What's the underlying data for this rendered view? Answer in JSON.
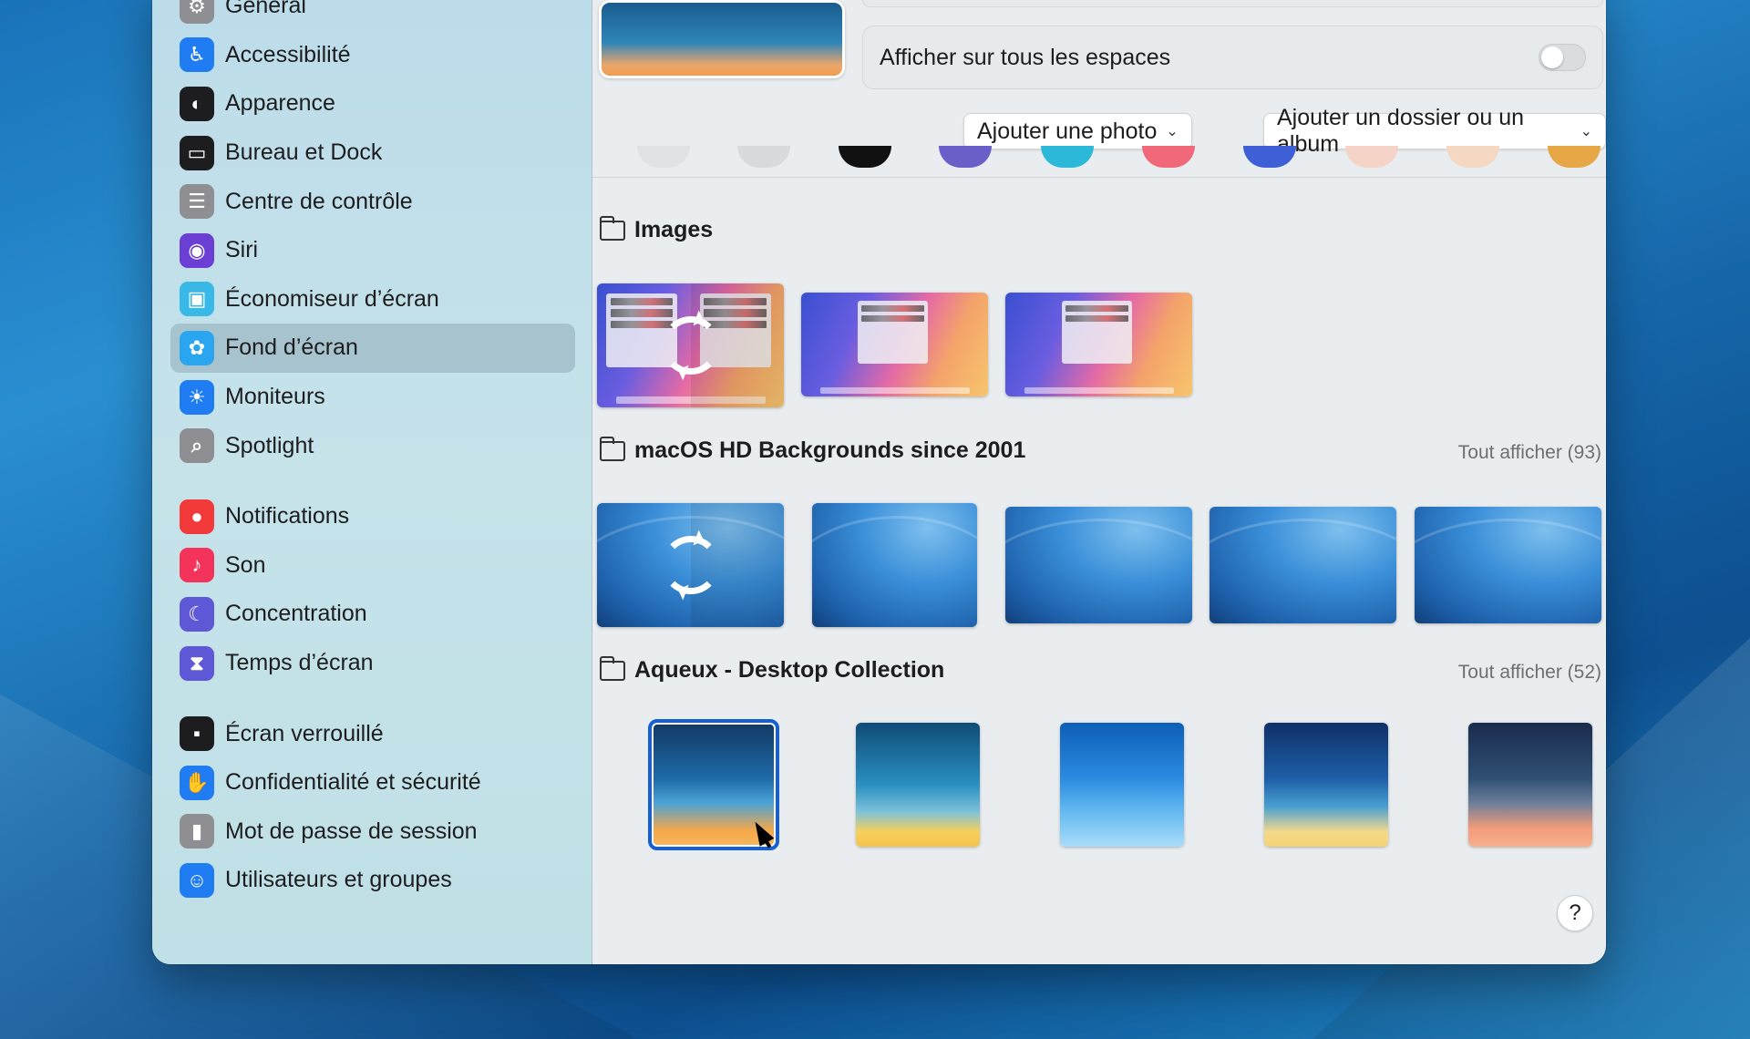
{
  "sidebar": {
    "group1": [
      {
        "label": "Général",
        "icon": "gear-icon",
        "color": "#8e8e93"
      },
      {
        "label": "Accessibilité",
        "icon": "accessibility-icon",
        "color": "#1f7cf3"
      },
      {
        "label": "Apparence",
        "icon": "appearance-icon",
        "color": "#1d1d1f"
      },
      {
        "label": "Bureau et Dock",
        "icon": "dock-icon",
        "color": "#1d1d1f"
      },
      {
        "label": "Centre de contrôle",
        "icon": "control-center-icon",
        "color": "#8e8e93"
      },
      {
        "label": "Siri",
        "icon": "siri-icon",
        "color": "#6b3fd4"
      },
      {
        "label": "Économiseur d’écran",
        "icon": "screensaver-icon",
        "color": "#3ab8e8"
      },
      {
        "label": "Fond d’écran",
        "icon": "wallpaper-icon",
        "color": "#2aa6f0",
        "selected": true
      },
      {
        "label": "Moniteurs",
        "icon": "displays-icon",
        "color": "#1f7cf3"
      },
      {
        "label": "Spotlight",
        "icon": "spotlight-icon",
        "color": "#8e8e93"
      }
    ],
    "group2": [
      {
        "label": "Notifications",
        "icon": "notifications-icon",
        "color": "#f33a3a"
      },
      {
        "label": "Son",
        "icon": "sound-icon",
        "color": "#f4335a"
      },
      {
        "label": "Concentration",
        "icon": "focus-icon",
        "color": "#5e57d6"
      },
      {
        "label": "Temps d’écran",
        "icon": "screen-time-icon",
        "color": "#5e57d6"
      }
    ],
    "group3": [
      {
        "label": "Écran verrouillé",
        "icon": "lock-screen-icon",
        "color": "#1d1d1f"
      },
      {
        "label": "Confidentialité et sécurité",
        "icon": "privacy-hand-icon",
        "color": "#1f7cf3"
      },
      {
        "label": "Mot de passe de session",
        "icon": "lock-icon",
        "color": "#8e8e93"
      },
      {
        "label": "Utilisateurs et groupes",
        "icon": "users-icon",
        "color": "#1f7cf3"
      }
    ]
  },
  "settings": {
    "show_all_spaces_label": "Afficher sur tous les espaces",
    "show_all_spaces_on": false
  },
  "buttons": {
    "add_photo": "Ajouter une photo",
    "add_folder": "Ajouter un dossier ou un album"
  },
  "sections": {
    "images": {
      "title": "Images"
    },
    "hd": {
      "title": "macOS HD Backgrounds since 2001",
      "show_all": "Tout afficher (93)"
    },
    "aqueux": {
      "title": "Aqueux - Desktop Collection",
      "show_all": "Tout afficher (52)"
    }
  },
  "help_label": "?"
}
